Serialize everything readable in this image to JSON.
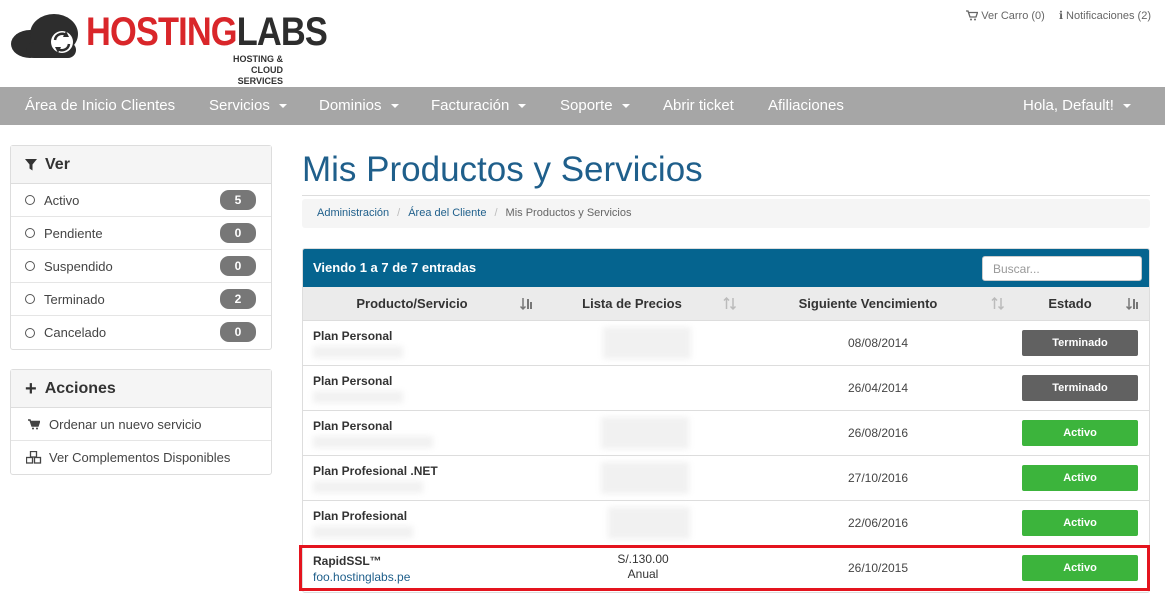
{
  "brand": {
    "name_part1": "HOSTING",
    "name_part2": "LABS",
    "tagline_line1": "HOSTING &",
    "tagline_line2": "CLOUD SERVICES",
    "color_red": "#d9262a",
    "color_dark": "#2d2d2d"
  },
  "top_links": {
    "cart": "Ver Carro (0)",
    "notifications": "Notificaciones (2)"
  },
  "nav": {
    "items": [
      {
        "label": "Área de Inicio Clientes",
        "dropdown": false
      },
      {
        "label": "Servicios",
        "dropdown": true
      },
      {
        "label": "Dominios",
        "dropdown": true
      },
      {
        "label": "Facturación",
        "dropdown": true
      },
      {
        "label": "Soporte",
        "dropdown": true
      },
      {
        "label": "Abrir ticket",
        "dropdown": false
      },
      {
        "label": "Afiliaciones",
        "dropdown": false
      }
    ],
    "user": "Hola, Default!"
  },
  "filter_panel": {
    "title": "Ver",
    "items": [
      {
        "label": "Activo",
        "count": "5"
      },
      {
        "label": "Pendiente",
        "count": "0"
      },
      {
        "label": "Suspendido",
        "count": "0"
      },
      {
        "label": "Terminado",
        "count": "2"
      },
      {
        "label": "Cancelado",
        "count": "0"
      }
    ]
  },
  "actions_panel": {
    "title": "Acciones",
    "items": [
      {
        "label": "Ordenar un nuevo servicio",
        "icon": "cart-icon"
      },
      {
        "label": "Ver Complementos Disponibles",
        "icon": "cubes-icon"
      }
    ]
  },
  "page": {
    "title": "Mis Productos y Servicios",
    "breadcrumb": [
      "Administración",
      "Área del Cliente",
      "Mis Productos y Servicios"
    ]
  },
  "table": {
    "info": "Viendo 1 a 7 de 7 entradas",
    "search_placeholder": "Buscar...",
    "columns": [
      "Producto/Servicio",
      "Lista de Precios",
      "Siguiente Vencimiento",
      "Estado"
    ],
    "rows": [
      {
        "product": "Plan Personal",
        "domain": "",
        "price": "",
        "cycle": "",
        "due": "08/08/2014",
        "status": "Terminado"
      },
      {
        "product": "Plan Personal",
        "domain": "",
        "price": "",
        "cycle": "",
        "due": "26/04/2014",
        "status": "Terminado"
      },
      {
        "product": "Plan Personal",
        "domain": "",
        "price": "",
        "cycle": "",
        "due": "26/08/2016",
        "status": "Activo"
      },
      {
        "product": "Plan Profesional .NET",
        "domain": "",
        "price": "",
        "cycle": "",
        "due": "27/10/2016",
        "status": "Activo"
      },
      {
        "product": "Plan Profesional",
        "domain": "",
        "price": "",
        "cycle": "",
        "due": "22/06/2016",
        "status": "Activo"
      },
      {
        "product": "RapidSSL™",
        "domain": "foo.hostinglabs.pe",
        "price": "S/.130.00",
        "cycle": "Anual",
        "due": "26/10/2015",
        "status": "Activo"
      }
    ],
    "status_colors": {
      "Terminado": "#616161",
      "Activo": "#3cb43c"
    }
  },
  "colors": {
    "navbar": "#a6a6a6",
    "table_header": "#05648f",
    "title": "#1f5f8b",
    "highlight": "#e4141e"
  }
}
